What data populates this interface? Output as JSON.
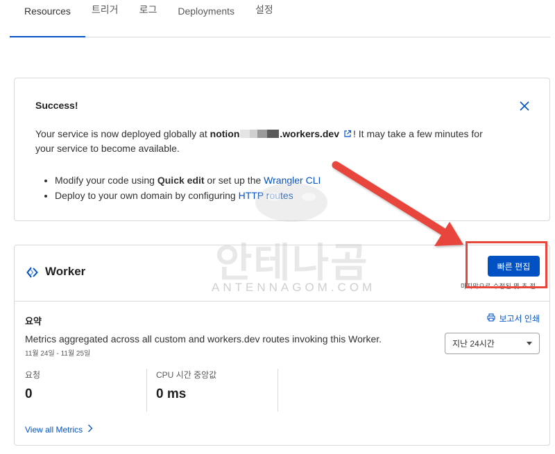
{
  "tabs": [
    {
      "label": "Resources"
    },
    {
      "label": "트리거"
    },
    {
      "label": "로그"
    },
    {
      "label": "Deployments"
    },
    {
      "label": "설정"
    }
  ],
  "success": {
    "title": "Success!",
    "line1_a": "Your service is now deployed globally at ",
    "line1_b": "notion",
    "line1_c": ".workers.dev",
    "line1_d": "! It may take a few minutes for",
    "line2": "your service to become available.",
    "bullet1_a": "Modify your code using ",
    "bullet1_b": "Quick edit",
    "bullet1_c": " or set up the ",
    "bullet1_link": "Wrangler CLI",
    "bullet2_a": "Deploy to your own domain by configuring ",
    "bullet2_link": "HTTP routes"
  },
  "worker": {
    "title": "Worker",
    "quick_edit_label": "빠른 편집",
    "quick_edit_sub": "마지막으로 수정된 몇 초 전",
    "summary_title": "요약",
    "print_label": "보고서 인쇄",
    "summary_desc": "Metrics aggregated across all custom and workers.dev routes invoking this Worker.",
    "summary_range": "11월 24일 - 11월 25일",
    "range_select": "지난 24시간",
    "metrics": [
      {
        "label": "요청",
        "value": "0"
      },
      {
        "label": "CPU 시간 중앙값",
        "value": "0 ms"
      }
    ],
    "view_all": "View all Metrics"
  },
  "watermark": {
    "text": "안테나곰",
    "sub": "ANTENNAGOM.COM"
  },
  "colors": {
    "accent": "#0051c3",
    "annotation_red": "#e8453c"
  }
}
